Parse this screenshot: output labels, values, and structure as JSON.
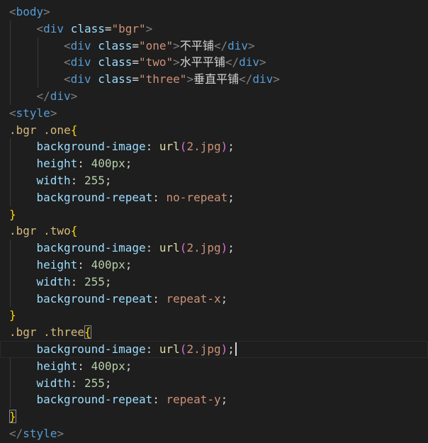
{
  "editor": {
    "language": "html",
    "lines": [
      {
        "indent": 0,
        "tokens": [
          [
            "punc",
            "<"
          ],
          [
            "tag",
            "body"
          ],
          [
            "punc",
            ">"
          ]
        ]
      },
      {
        "indent": 1,
        "tokens": [
          [
            "punc",
            "<"
          ],
          [
            "tag",
            "div"
          ],
          [
            "text",
            " "
          ],
          [
            "attr",
            "class"
          ],
          [
            "text",
            "="
          ],
          [
            "str",
            "\"bgr\""
          ],
          [
            "punc",
            ">"
          ]
        ]
      },
      {
        "indent": 2,
        "tokens": [
          [
            "punc",
            "<"
          ],
          [
            "tag",
            "div"
          ],
          [
            "text",
            " "
          ],
          [
            "attr",
            "class"
          ],
          [
            "text",
            "="
          ],
          [
            "str",
            "\"one\""
          ],
          [
            "punc",
            ">"
          ],
          [
            "text",
            "不平铺"
          ],
          [
            "punc",
            "</"
          ],
          [
            "tag",
            "div"
          ],
          [
            "punc",
            ">"
          ]
        ]
      },
      {
        "indent": 2,
        "tokens": [
          [
            "punc",
            "<"
          ],
          [
            "tag",
            "div"
          ],
          [
            "text",
            " "
          ],
          [
            "attr",
            "class"
          ],
          [
            "text",
            "="
          ],
          [
            "str",
            "\"two\""
          ],
          [
            "punc",
            ">"
          ],
          [
            "text",
            "水平平铺"
          ],
          [
            "punc",
            "</"
          ],
          [
            "tag",
            "div"
          ],
          [
            "punc",
            ">"
          ]
        ]
      },
      {
        "indent": 2,
        "tokens": [
          [
            "punc",
            "<"
          ],
          [
            "tag",
            "div"
          ],
          [
            "text",
            " "
          ],
          [
            "attr",
            "class"
          ],
          [
            "text",
            "="
          ],
          [
            "str",
            "\"three\""
          ],
          [
            "punc",
            ">"
          ],
          [
            "text",
            "垂直平铺"
          ],
          [
            "punc",
            "</"
          ],
          [
            "tag",
            "div"
          ],
          [
            "punc",
            ">"
          ]
        ]
      },
      {
        "indent": 1,
        "tokens": [
          [
            "punc",
            "</"
          ],
          [
            "tag",
            "div"
          ],
          [
            "punc",
            ">"
          ]
        ]
      },
      {
        "indent": 0,
        "tokens": [
          [
            "punc",
            "<"
          ],
          [
            "tag",
            "style"
          ],
          [
            "punc",
            ">"
          ]
        ]
      },
      {
        "indent": 0,
        "tokens": [
          [
            "sel",
            ".bgr .one"
          ],
          [
            "brace",
            "{"
          ]
        ]
      },
      {
        "indent": 1,
        "tokens": [
          [
            "prop",
            "background-image"
          ],
          [
            "text",
            ": "
          ],
          [
            "fn",
            "url"
          ],
          [
            "paren",
            "("
          ],
          [
            "val",
            "2.jpg"
          ],
          [
            "paren",
            ")"
          ],
          [
            "semi",
            ";"
          ]
        ]
      },
      {
        "indent": 1,
        "tokens": [
          [
            "prop",
            "height"
          ],
          [
            "text",
            ": "
          ],
          [
            "num",
            "400px"
          ],
          [
            "semi",
            ";"
          ]
        ]
      },
      {
        "indent": 1,
        "tokens": [
          [
            "prop",
            "width"
          ],
          [
            "text",
            ": "
          ],
          [
            "num",
            "255"
          ],
          [
            "semi",
            ";"
          ]
        ]
      },
      {
        "indent": 1,
        "tokens": [
          [
            "prop",
            "background-repeat"
          ],
          [
            "text",
            ": "
          ],
          [
            "val",
            "no-repeat"
          ],
          [
            "semi",
            ";"
          ]
        ]
      },
      {
        "indent": 0,
        "tokens": [
          [
            "brace",
            "}"
          ]
        ]
      },
      {
        "indent": 0,
        "tokens": [
          [
            "sel",
            ".bgr .two"
          ],
          [
            "brace",
            "{"
          ]
        ]
      },
      {
        "indent": 1,
        "tokens": [
          [
            "prop",
            "background-image"
          ],
          [
            "text",
            ": "
          ],
          [
            "fn",
            "url"
          ],
          [
            "paren",
            "("
          ],
          [
            "val",
            "2.jpg"
          ],
          [
            "paren",
            ")"
          ],
          [
            "semi",
            ";"
          ]
        ]
      },
      {
        "indent": 1,
        "tokens": [
          [
            "prop",
            "height"
          ],
          [
            "text",
            ": "
          ],
          [
            "num",
            "400px"
          ],
          [
            "semi",
            ";"
          ]
        ]
      },
      {
        "indent": 1,
        "tokens": [
          [
            "prop",
            "width"
          ],
          [
            "text",
            ": "
          ],
          [
            "num",
            "255"
          ],
          [
            "semi",
            ";"
          ]
        ]
      },
      {
        "indent": 1,
        "tokens": [
          [
            "prop",
            "background-repeat"
          ],
          [
            "text",
            ": "
          ],
          [
            "val",
            "repeat-x"
          ],
          [
            "semi",
            ";"
          ]
        ]
      },
      {
        "indent": 0,
        "tokens": [
          [
            "brace",
            "}"
          ]
        ]
      },
      {
        "indent": 0,
        "tokens": [
          [
            "sel",
            ".bgr .three"
          ],
          [
            "brace",
            "{"
          ]
        ]
      },
      {
        "indent": 1,
        "current": true,
        "cursor_after": 6,
        "tokens": [
          [
            "prop",
            "background-image"
          ],
          [
            "text",
            ": "
          ],
          [
            "fn",
            "url"
          ],
          [
            "paren",
            "("
          ],
          [
            "val",
            "2.jpg"
          ],
          [
            "paren",
            ")"
          ],
          [
            "semi",
            ";"
          ]
        ]
      },
      {
        "indent": 1,
        "tokens": [
          [
            "prop",
            "height"
          ],
          [
            "text",
            ": "
          ],
          [
            "num",
            "400px"
          ],
          [
            "semi",
            ";"
          ]
        ]
      },
      {
        "indent": 1,
        "tokens": [
          [
            "prop",
            "width"
          ],
          [
            "text",
            ": "
          ],
          [
            "num",
            "255"
          ],
          [
            "semi",
            ";"
          ]
        ]
      },
      {
        "indent": 1,
        "tokens": [
          [
            "prop",
            "background-repeat"
          ],
          [
            "text",
            ": "
          ],
          [
            "val",
            "repeat-y"
          ],
          [
            "semi",
            ";"
          ]
        ]
      },
      {
        "indent": 0,
        "tokens": [
          [
            "brace",
            "}"
          ]
        ]
      },
      {
        "indent": 0,
        "tokens": [
          [
            "punc",
            "</"
          ],
          [
            "tag",
            "style"
          ],
          [
            "punc",
            ">"
          ]
        ]
      }
    ]
  },
  "colors": {
    "background": "#1e1e1e",
    "tag": "#569cd6",
    "attribute": "#9cdcfe",
    "string": "#ce9178",
    "selector": "#d7ba7d",
    "function": "#dcdcaa",
    "number": "#b5cea8",
    "brace": "#ffd700",
    "paren": "#da70d6"
  }
}
